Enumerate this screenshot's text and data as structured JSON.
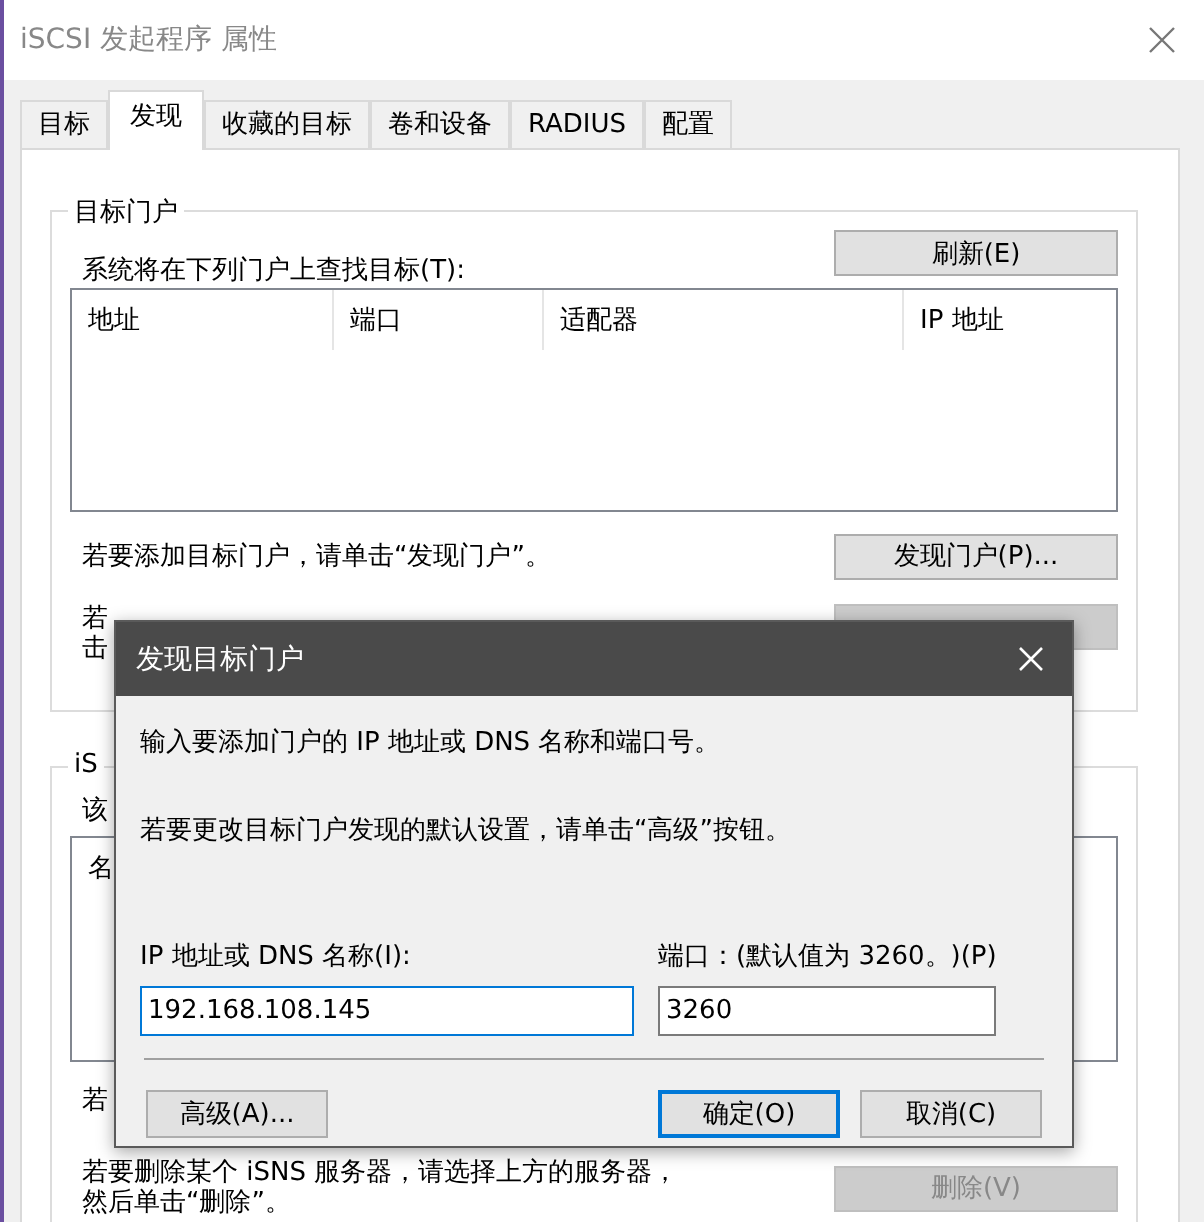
{
  "window": {
    "title": "iSCSI 发起程序 属性"
  },
  "tabs": [
    {
      "label": "目标",
      "selected": false
    },
    {
      "label": "发现",
      "selected": true
    },
    {
      "label": "收藏的目标",
      "selected": false
    },
    {
      "label": "卷和设备",
      "selected": false
    },
    {
      "label": "RADIUS",
      "selected": false
    },
    {
      "label": "配置",
      "selected": false
    }
  ],
  "portal_group": {
    "title": "目标门户",
    "refresh_button": "刷新(E)",
    "list_label": "系统将在下列门户上查找目标(T):",
    "columns": [
      "地址",
      "端口",
      "适配器",
      "IP 地址"
    ],
    "add_hint": "若要添加目标门户，请单击“发现门户”。",
    "discover_button": "发现门户(P)...",
    "remove_hint": [
      "若",
      "击"
    ],
    "remove_button": {
      "disabled": true
    }
  },
  "isns_group": {
    "title": "iS",
    "list_label": "该",
    "column_1": "名",
    "add_hint": "若",
    "remove_hint": [
      "若要删除某个 iSNS 服务器，请选择上方的服务器，",
      "然后单击“删除”。"
    ],
    "remove_button": {
      "label": "删除(V)",
      "disabled": true
    }
  },
  "dialog": {
    "title": "发现目标门户",
    "intro": "输入要添加门户的 IP 地址或 DNS 名称和端口号。",
    "advanced_hint": "若要更改目标门户发现的默认设置，请单击“高级”按钮。",
    "address_label": "IP 地址或 DNS 名称(I):",
    "address_value": "192.168.108.145",
    "port_label": "端口：(默认值为 3260。)(P)",
    "port_value": "3260",
    "buttons": [
      {
        "label": "高级(A)...",
        "kind": "secondary"
      },
      {
        "label": "确定(O)",
        "kind": "default"
      },
      {
        "label": "取消(C)",
        "kind": "secondary"
      }
    ]
  }
}
